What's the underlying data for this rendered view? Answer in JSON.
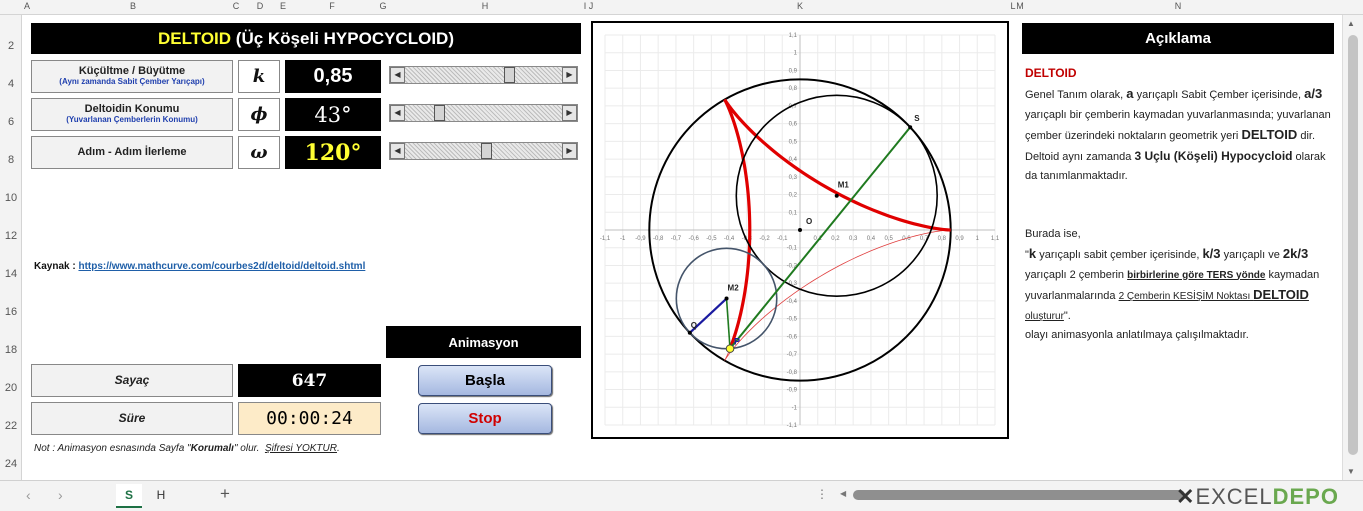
{
  "columns": [
    "A",
    "B",
    "C",
    "D",
    "E",
    "F",
    "G",
    "H",
    "I",
    "J",
    "K",
    "L",
    "M",
    "N"
  ],
  "rows": [
    "2",
    "4",
    "6",
    "8",
    "10",
    "12",
    "14",
    "16",
    "18",
    "20",
    "22",
    "24"
  ],
  "title": {
    "main": "DELTOID",
    "rest": "(Üç Köşeli HYPOCYCLOID)"
  },
  "params": [
    {
      "label": "Küçültme / Büyütme",
      "sublabel": "(Aynı zamanda Sabit Çember Yarıçapı)",
      "symbol": "k",
      "value": "0,85",
      "thumb_pos": 0.68
    },
    {
      "label": "Deltoidin Konumu",
      "sublabel": "(Yuvarlanan Çemberlerin Konumu)",
      "symbol": "ϕ",
      "value": "43°",
      "thumb_pos": 0.2
    },
    {
      "label": "Adım - Adım İlerleme",
      "sublabel": "",
      "symbol": "ω",
      "value": "120°",
      "thumb_pos": 0.52
    }
  ],
  "source": {
    "label": "Kaynak :",
    "link": "https://www.mathcurve.com/courbes2d/deltoid/deltoid.shtml"
  },
  "animation": {
    "header": "Animasyon",
    "start": "Başla",
    "stop": "Stop"
  },
  "counter": {
    "label": "Sayaç",
    "value": "647"
  },
  "duration": {
    "label": "Süre",
    "value": "00:00:24"
  },
  "note": {
    "prefix": "Not : Animasyon esnasında Sayfa \"",
    "bold": "Korumalı",
    "mid": "\" olur.",
    "link": "Şifresi YOKTUR",
    "end": "."
  },
  "description": {
    "header": "Açıklama",
    "title": "DELTOID",
    "p1": [
      "Genel Tanım olarak, ",
      "a",
      "  yarıçaplı  Sabit Çember içerisinde,  ",
      "a/3",
      "  yarıçaplı bir çemberin kaymadan yuvarlanmasında; yuvarlanan çember üzerindeki noktaların geometrik yeri ",
      "DELTOID",
      " dir. Deltoid aynı zamanda ",
      "3 Uçlu (Köşeli) Hypocycloid",
      " olarak da tanımlanmaktadır."
    ],
    "p2a": "Burada ise,",
    "p2": [
      "\"",
      "k",
      "  yarıçaplı sabit çember içerisinde, ",
      "k/3",
      "  yarıçaplı  ve ",
      "2k/3",
      "  yarıçaplı  2 çemberin ",
      "birbirlerine göre TERS yönde",
      " kaymadan yuvarlanmalarında ",
      "2 Çemberin KESİŞİM Noktası ",
      "DELTOID",
      " oluşturur",
      "\"."
    ],
    "p3": "olayı animasyonla anlatılmaya çalışılmaktadır."
  },
  "chart_data": {
    "type": "scatter",
    "xlim": [
      -1.1,
      1.1
    ],
    "ylim": [
      -1.1,
      1.1
    ],
    "ticks": [
      -1.1,
      -1,
      -0.9,
      -0.8,
      -0.7,
      -0.6,
      -0.5,
      -0.4,
      -0.3,
      -0.2,
      -0.1,
      0,
      0.1,
      0.2,
      0.3,
      0.4,
      0.5,
      0.6,
      0.7,
      0.8,
      0.9,
      1,
      1.1
    ],
    "grid": true,
    "k": 0.85,
    "phi_deg": 43,
    "omega_deg": 120,
    "colors": {
      "fixed": "#000000",
      "rolling_small": "#44546a",
      "rolling_big": "#000000",
      "deltoid_thin": "#e04040",
      "deltoid_thick": "#e00000",
      "diameter": "#1f7a1f",
      "small_radius": "#1a1aa0"
    },
    "labels": {
      "origin": "O",
      "S": "S",
      "M1": "M1",
      "M2": "M2",
      "P": "P",
      "Q": "Q"
    }
  },
  "sheets": [
    "S",
    "H"
  ],
  "brand": {
    "a": "EXCEL",
    "b": "DEPO"
  }
}
